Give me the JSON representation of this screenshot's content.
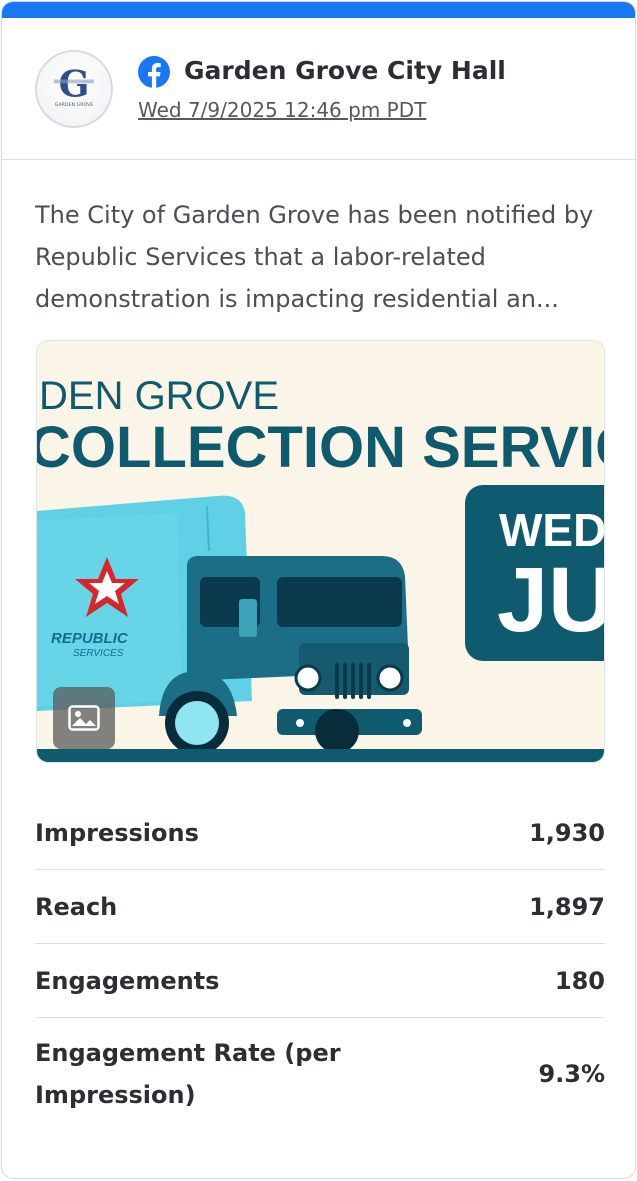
{
  "colors": {
    "accent_bar": "#1877f2",
    "facebook_blue": "#1877f2",
    "text_primary": "#2b2f33",
    "text_secondary": "#555a5f"
  },
  "post": {
    "avatar_logo_text": "GARDEN GROVE",
    "platform_icon": "facebook-icon",
    "page_name": "Garden Grove City Hall",
    "date": "Wed 7/9/2025 12:46 pm PDT",
    "message": "The City of Garden Grove has been notified by Republic Services that a labor-related demonstration is impacting residential an..."
  },
  "media": {
    "headline_small": "DEN GROVE",
    "headline_large": "COLLECTION SERVIC",
    "brand_line1": "REPUBLIC",
    "brand_line2": "SERVICES",
    "date_line1": "WED",
    "date_line2": "JU",
    "type_icon": "image-icon"
  },
  "metrics": [
    {
      "label": "Impressions",
      "value": "1,930"
    },
    {
      "label": "Reach",
      "value": "1,897"
    },
    {
      "label": "Engagements",
      "value": "180"
    },
    {
      "label": "Engagement Rate (per Impression)",
      "value": "9.3%"
    }
  ]
}
